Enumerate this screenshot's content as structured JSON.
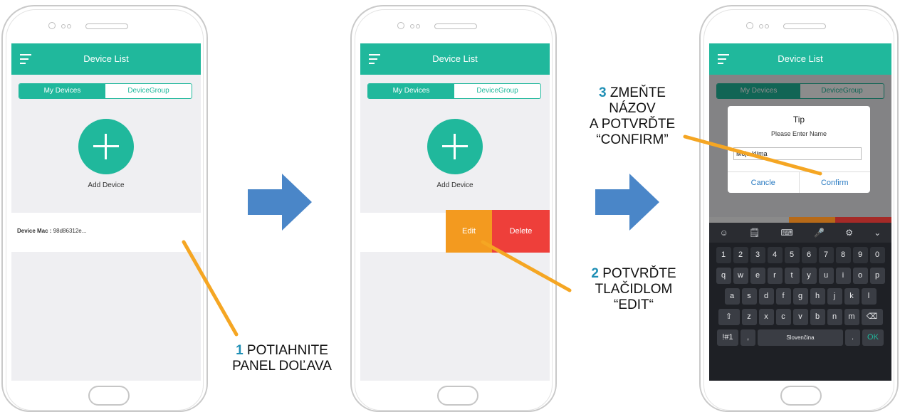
{
  "app": {
    "title": "Device List",
    "tab_my_devices": "My Devices",
    "tab_device_group": "DeviceGroup",
    "add_device": "Add Device",
    "device_mac_label": "Device Mac :",
    "device_mac_value": "98d86312e...",
    "edit": "Edit",
    "delete": "Delete"
  },
  "dialog": {
    "title": "Tip",
    "subtitle": "Please Enter Name",
    "input_value": "Moja klíma",
    "cancel": "Cancle",
    "confirm": "Confirm"
  },
  "keyboard": {
    "numbers": [
      "1",
      "2",
      "3",
      "4",
      "5",
      "6",
      "7",
      "8",
      "9",
      "0"
    ],
    "row1": [
      "q",
      "w",
      "e",
      "r",
      "t",
      "y",
      "u",
      "i",
      "o",
      "p"
    ],
    "row2": [
      "a",
      "s",
      "d",
      "f",
      "g",
      "h",
      "j",
      "k",
      "l"
    ],
    "row3": [
      "z",
      "x",
      "c",
      "v",
      "b",
      "n",
      "m"
    ],
    "shift": "⇧",
    "backspace": "⌫",
    "sym": "!#1",
    "comma": ",",
    "space": "Slovenčina",
    "period": ".",
    "ok": "OK",
    "tools": [
      "☺",
      "🗒",
      "⌨",
      "🎤",
      "⚙",
      "⌄"
    ]
  },
  "steps": {
    "s1_num": "1",
    "s1_line1": "POTIAHNITE",
    "s1_line2": "PANEL DOĽAVA",
    "s2_num": "2",
    "s2_line1": "POTVRĎTE",
    "s2_line2": "TLAČIDLOM",
    "s2_line3": "“EDIT“",
    "s3_num": "3",
    "s3_line1": "ZMEŇTE",
    "s3_line2": "NÁZOV",
    "s3_line3": "A POTVRĎTE",
    "s3_line4": "“CONFIRM”"
  },
  "colors": {
    "accent": "#20b89c",
    "edit": "#f39a1f",
    "delete": "#ee3f3a",
    "arrow": "#4a86c8",
    "pointer": "#f5a623",
    "step_number": "#1f8fb5"
  }
}
